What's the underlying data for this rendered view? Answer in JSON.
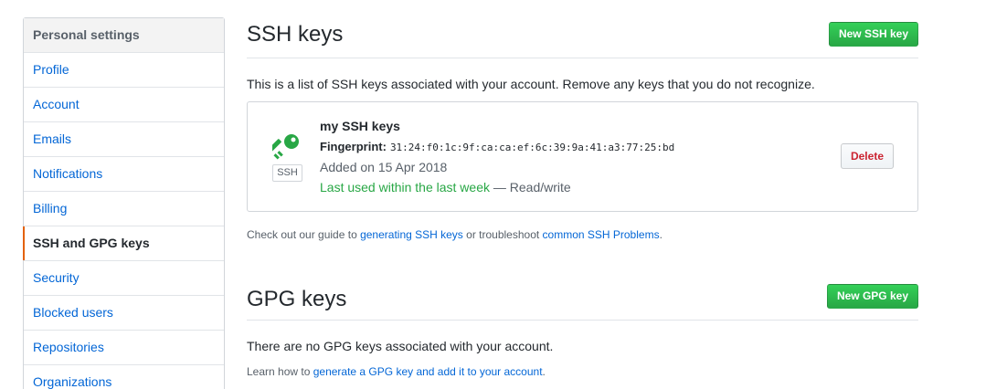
{
  "sidebar": {
    "header": "Personal settings",
    "items": [
      {
        "label": "Profile"
      },
      {
        "label": "Account"
      },
      {
        "label": "Emails"
      },
      {
        "label": "Notifications"
      },
      {
        "label": "Billing"
      },
      {
        "label": "SSH and GPG keys",
        "selected": true
      },
      {
        "label": "Security"
      },
      {
        "label": "Blocked users"
      },
      {
        "label": "Repositories"
      },
      {
        "label": "Organizations"
      }
    ]
  },
  "ssh": {
    "title": "SSH keys",
    "new_button": "New SSH key",
    "description": "This is a list of SSH keys associated with your account. Remove any keys that you do not recognize.",
    "key": {
      "icon": "key-icon",
      "type_label": "SSH",
      "name": "my SSH keys",
      "fingerprint_label": "Fingerprint:",
      "fingerprint": "31:24:f0:1c:9f:ca:ca:ef:6c:39:9a:41:a3:77:25:bd",
      "added": "Added on 15 Apr 2018",
      "last_used": "Last used within the last week",
      "separator": " — ",
      "access": "Read/write",
      "delete_button": "Delete"
    },
    "note_prefix": "Check out our guide to ",
    "note_link1": "generating SSH keys",
    "note_middle": " or troubleshoot ",
    "note_link2": "common SSH Problems",
    "note_suffix": "."
  },
  "gpg": {
    "title": "GPG keys",
    "new_button": "New GPG key",
    "description": "There are no GPG keys associated with your account.",
    "note_prefix": "Learn how to ",
    "note_link": "generate a GPG key and add it to your account",
    "note_suffix": "."
  },
  "colors": {
    "accent_green": "#28a745",
    "link_blue": "#0366d6",
    "danger_red": "#cb2431",
    "selected_bar": "#e36209"
  }
}
